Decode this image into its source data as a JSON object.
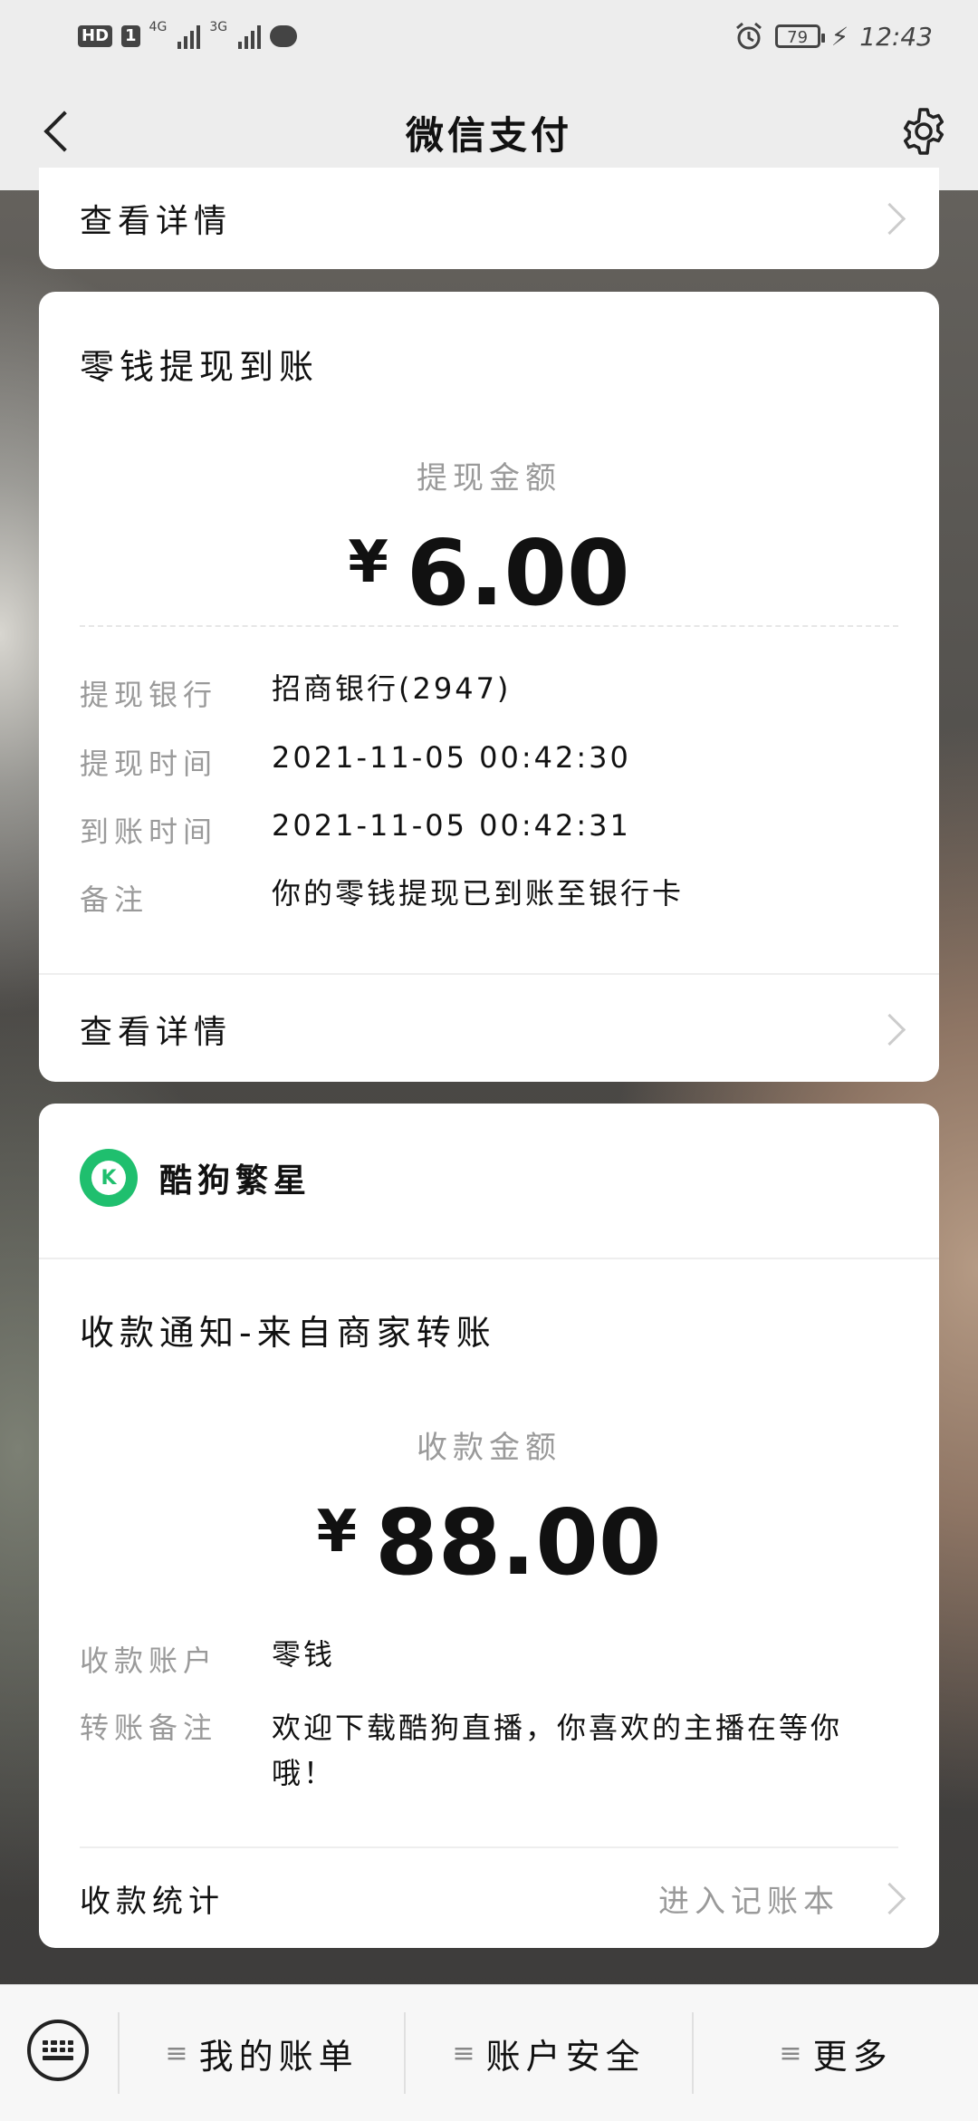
{
  "status_bar": {
    "hd": "HD",
    "sim1": "1",
    "net1": "4G",
    "net2": "3G",
    "battery": "79",
    "time": "12:43"
  },
  "navbar": {
    "title": "微信支付"
  },
  "top_card": {
    "link_label": "查看详情"
  },
  "withdraw_card": {
    "title": "零钱提现到账",
    "amount_label": "提现金额",
    "currency": "¥",
    "amount": "6.00",
    "rows": [
      {
        "key": "提现银行",
        "value": "招商银行(2947)"
      },
      {
        "key": "提现时间",
        "value": "2021-11-05 00:42:30"
      },
      {
        "key": "到账时间",
        "value": "2021-11-05 00:42:31"
      },
      {
        "key": "备注",
        "value": "你的零钱提现已到账至银行卡"
      }
    ],
    "link_label": "查看详情"
  },
  "payment_card": {
    "merchant_name": "酷狗繁星",
    "merchant_logo_letter": "K",
    "title": "收款通知-来自商家转账",
    "amount_label": "收款金额",
    "currency": "¥",
    "amount": "88.00",
    "rows": [
      {
        "key": "收款账户",
        "value": "零钱"
      },
      {
        "key": "转账备注",
        "value": "欢迎下载酷狗直播，你喜欢的主播在等你哦！"
      }
    ],
    "stat_label": "收款统计",
    "stat_link": "进入记账本"
  },
  "bottom_menu": {
    "items": [
      "我的账单",
      "账户安全",
      "更多"
    ],
    "hamburger": "≡"
  }
}
